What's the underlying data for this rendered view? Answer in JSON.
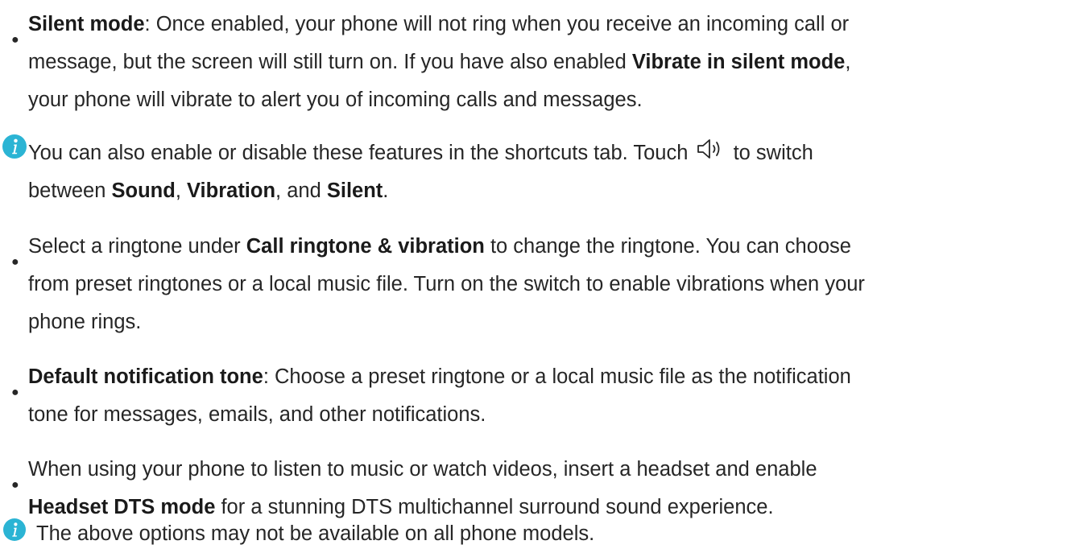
{
  "colors": {
    "info_icon": "#2bb4d4",
    "text": "#262626"
  },
  "items": [
    {
      "lines": [
        {
          "parts": [
            {
              "t": "Silent mode",
              "b": true
            },
            {
              "t": ": Once enabled, your phone will not ring when you receive an incoming call or"
            }
          ]
        },
        {
          "parts": [
            {
              "t": "message, but the screen will still turn on. If you have also enabled "
            },
            {
              "t": "Vibrate in silent mode",
              "b": true
            },
            {
              "t": ","
            }
          ]
        },
        {
          "parts": [
            {
              "t": "your phone will vibrate to alert you of incoming calls and messages."
            }
          ]
        }
      ]
    },
    {
      "note": true,
      "icon": "info-icon",
      "lines": [
        {
          "parts": [
            {
              "t": "You can also enable or disable these features in the shortcuts tab. Touch "
            },
            {
              "icon": "speaker-icon"
            },
            {
              "t": " to switch"
            }
          ]
        },
        {
          "parts": [
            {
              "t": "between "
            },
            {
              "t": "Sound",
              "b": true
            },
            {
              "t": ", "
            },
            {
              "t": "Vibration",
              "b": true
            },
            {
              "t": ", and "
            },
            {
              "t": "Silent",
              "b": true
            },
            {
              "t": "."
            }
          ]
        }
      ]
    },
    {
      "lines": [
        {
          "parts": [
            {
              "t": "Select a ringtone under "
            },
            {
              "t": "Call ringtone & vibration",
              "b": true
            },
            {
              "t": " to change the ringtone. You can choose"
            }
          ]
        },
        {
          "parts": [
            {
              "t": "from preset ringtones or a local music file. Turn on the switch to enable vibrations when your"
            }
          ]
        },
        {
          "parts": [
            {
              "t": "phone rings."
            }
          ]
        }
      ]
    },
    {
      "lines": [
        {
          "parts": [
            {
              "t": "Default notification tone",
              "b": true
            },
            {
              "t": ": Choose a preset ringtone or a local music file as the notification"
            }
          ]
        },
        {
          "parts": [
            {
              "t": "tone for messages, emails, and other notifications."
            }
          ]
        }
      ]
    },
    {
      "lines": [
        {
          "parts": [
            {
              "t": "When using your phone to listen to music or watch videos, insert a headset and enable"
            }
          ]
        },
        {
          "parts": [
            {
              "t": "Headset DTS mode",
              "b": true
            },
            {
              "t": " for a stunning DTS multichannel surround sound experience."
            }
          ]
        }
      ]
    },
    {
      "note": true,
      "icon": "info-icon",
      "lines": [
        {
          "parts": [
            {
              "t": "The above options may not be available on all phone models."
            }
          ]
        }
      ]
    }
  ]
}
